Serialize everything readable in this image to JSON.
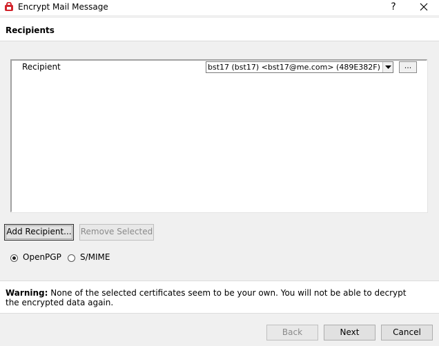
{
  "window": {
    "title": "Encrypt Mail Message",
    "help": "?",
    "icon": "kleopatra-app-icon"
  },
  "page": {
    "title": "Recipients"
  },
  "recipients": {
    "label": "Recipient",
    "selected": "bst17 (bst17) <bst17@me.com> (489E382F)",
    "more_label": "..."
  },
  "actions": {
    "add_recipient": "Add Recipient...",
    "remove_selected": "Remove Selected"
  },
  "protocol": {
    "options": [
      "OpenPGP",
      "S/MIME"
    ],
    "selected": "OpenPGP"
  },
  "warning": {
    "label": "Warning:",
    "message": "None of the selected certificates seem to be your own. You will not be able to decrypt the encrypted data again."
  },
  "footer": {
    "back": "Back",
    "next": "Next",
    "cancel": "Cancel"
  },
  "colors": {
    "window_bg": "#f0f0f0",
    "panel_bg": "#ffffff",
    "icon_red": "#d2242c"
  }
}
